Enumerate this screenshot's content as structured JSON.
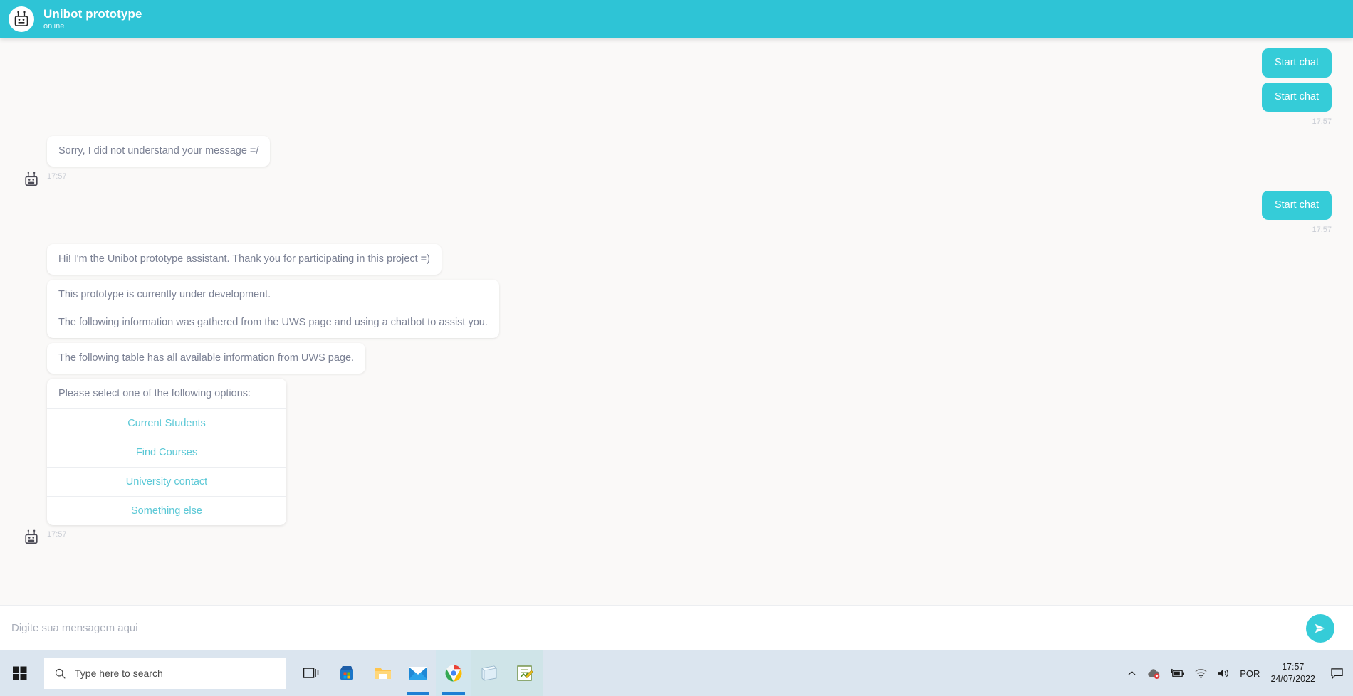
{
  "header": {
    "title": "Unibot prototype",
    "status": "online",
    "avatar_icon": "robot-icon",
    "bg_color": "#2ec4d6"
  },
  "conversation": [
    {
      "side": "user",
      "bubbles": [
        "Start chat",
        "Start chat"
      ],
      "time": "17:57"
    },
    {
      "side": "bot",
      "bubbles": [
        "Sorry, I did not understand your message =/"
      ],
      "time": "17:57"
    },
    {
      "side": "user",
      "bubbles": [
        "Start chat"
      ],
      "time": "17:57"
    }
  ],
  "bot_block": {
    "avatar_icon": "robot-icon",
    "bubble1": "Hi! I'm the Unibot prototype assistant. Thank you for participating in this project =)",
    "bubble2_line1": "This prototype is currently under development.",
    "bubble2_line2": "The following information was gathered from the UWS page and using a chatbot to assist you.",
    "bubble3": "The following table has all available information from UWS page.",
    "options_title": "Please select one of the following options:",
    "options": [
      "Current Students",
      "Find Courses",
      "University contact",
      "Something else"
    ],
    "time": "17:57"
  },
  "composer": {
    "placeholder": "Digite sua mensagem aqui",
    "value": "",
    "send_icon": "send-icon",
    "send_color": "#35ccd8"
  },
  "taskbar": {
    "start_icon": "windows-logo-icon",
    "search_placeholder": "Type here to search",
    "search_icon": "search-icon",
    "items": [
      {
        "name": "task-view",
        "icon": "task-view-icon"
      },
      {
        "name": "microsoft-store",
        "icon": "microsoft-store-icon"
      },
      {
        "name": "file-explorer",
        "icon": "folder-icon"
      },
      {
        "name": "mail",
        "icon": "mail-icon"
      },
      {
        "name": "google-chrome",
        "icon": "chrome-icon"
      },
      {
        "name": "notepad",
        "icon": "notepad-icon"
      },
      {
        "name": "editor",
        "icon": "editor-icon"
      }
    ],
    "tray": {
      "chevron": "chevron-up-icon",
      "onedrive": "cloud-error-icon",
      "battery": "battery-icon",
      "wifi": "wifi-icon",
      "volume": "volume-icon",
      "language": "POR",
      "time": "17:57",
      "date": "24/07/2022",
      "notifications": "notification-icon"
    }
  }
}
